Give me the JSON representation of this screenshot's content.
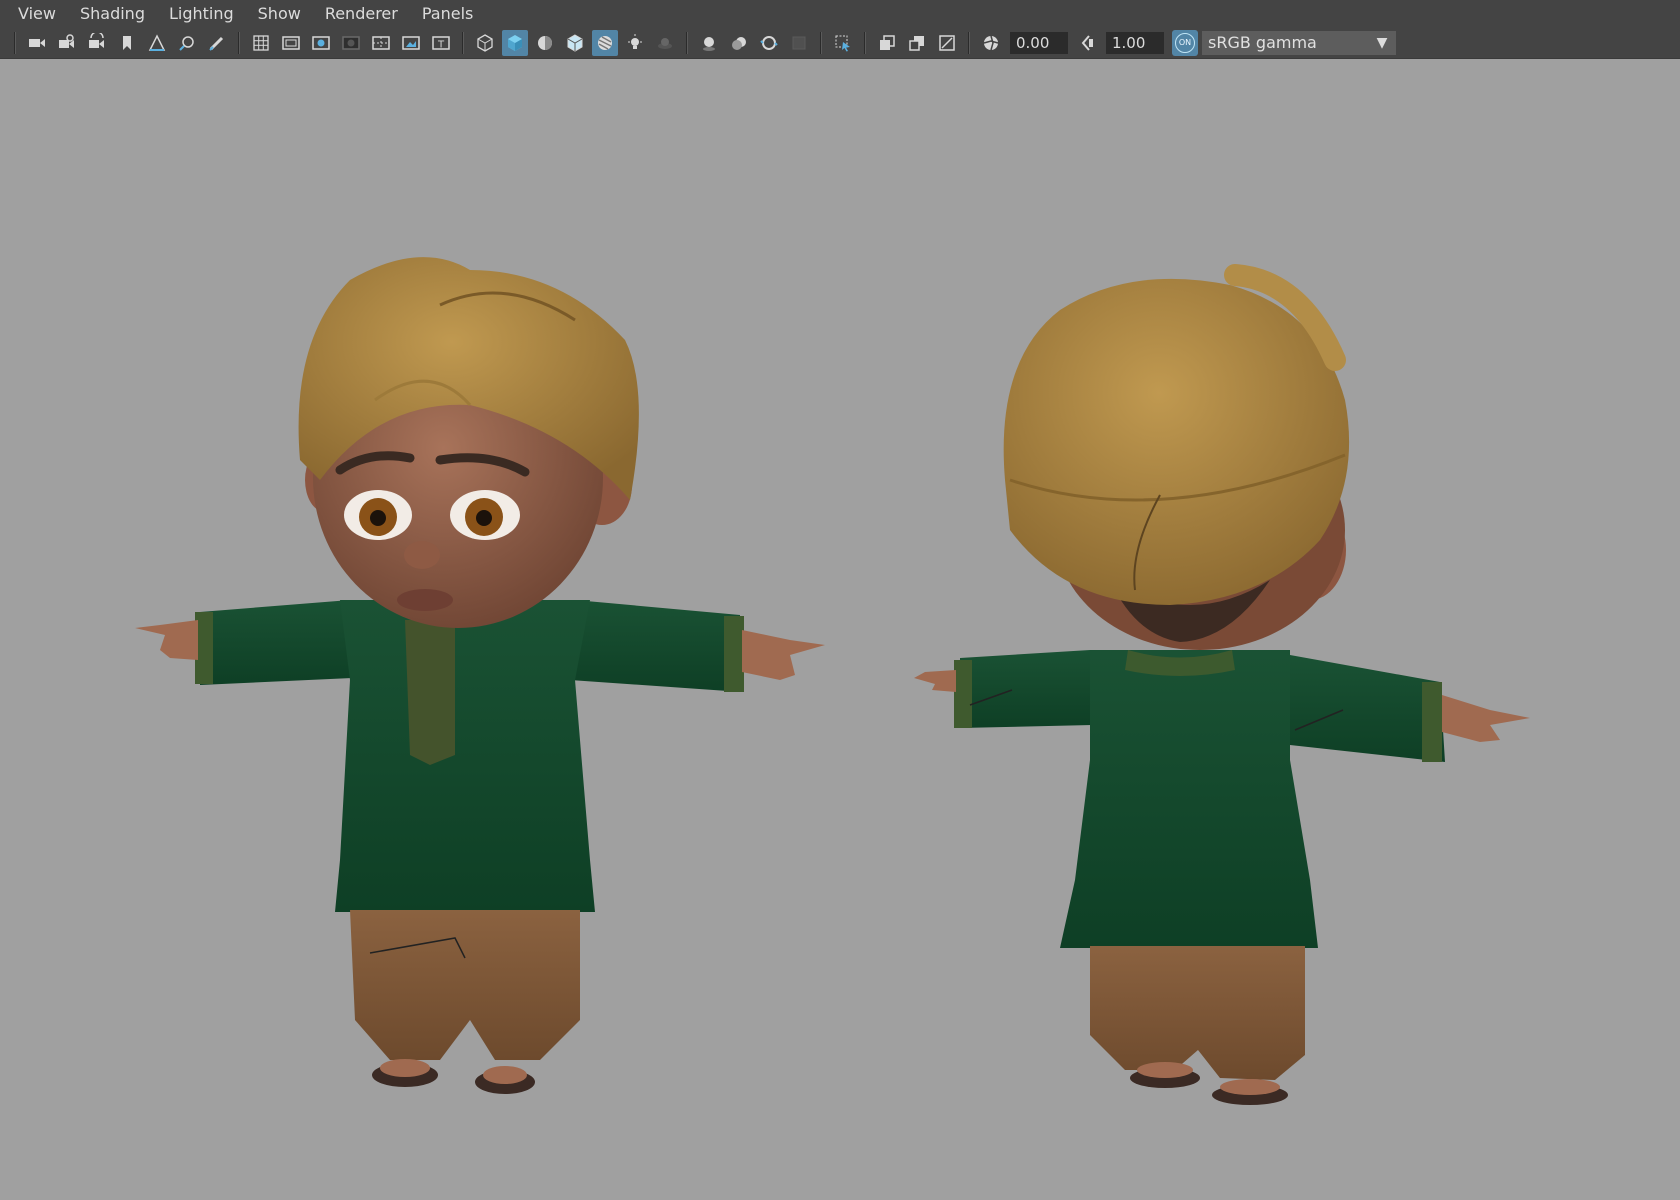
{
  "menubar": {
    "items": [
      "View",
      "Shading",
      "Lighting",
      "Show",
      "Renderer",
      "Panels"
    ]
  },
  "toolbar": {
    "icons_group1": [
      "camera-icon",
      "camera-attributes-icon",
      "camera-bookmark-icon",
      "bookmark-icon",
      "image-plane-icon",
      "2d-pan-zoom-icon",
      "grease-pencil-icon"
    ],
    "icons_group2": [
      "grid-icon",
      "film-gate-icon",
      "resolution-gate-icon",
      "gate-mask-icon",
      "field-chart-icon",
      "safe-action-icon",
      "safe-title-icon"
    ],
    "icons_group3": [
      "wireframe-icon",
      "smooth-shade-icon",
      "default-material-icon",
      "wireframe-on-shaded-icon",
      "xray-icon",
      "use-lights-icon",
      "shadows-icon"
    ],
    "icons_group4": [
      "screen-space-ao-icon",
      "motion-blur-icon",
      "multisample-aa-icon",
      "depth-of-field-icon"
    ],
    "icons_group5": [
      "isolate-select-icon"
    ],
    "icons_group6": [
      "xray-joints-icon",
      "xray-active-components-icon",
      "backface-culling-icon"
    ],
    "exposure_value": "0.00",
    "gamma_value": "1.00",
    "color_management": "ON",
    "colorspace_label": "sRGB gamma",
    "accent_color": "#5285a6"
  },
  "viewport": {
    "background": "#a0a0a0",
    "characters": [
      "character-front-view",
      "character-back-view"
    ]
  }
}
